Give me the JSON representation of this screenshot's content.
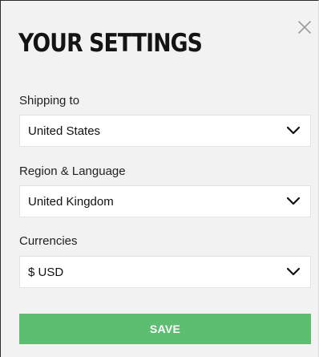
{
  "dialog": {
    "title": "YOUR SETTINGS",
    "close_icon": "close-icon"
  },
  "fields": {
    "shipping": {
      "label": "Shipping to",
      "value": "United States"
    },
    "region": {
      "label": "Region & Language",
      "value": "United Kingdom"
    },
    "currency": {
      "label": "Currencies",
      "value": "$ USD"
    }
  },
  "actions": {
    "save_label": "SAVE"
  },
  "colors": {
    "panel_background": "#f2f2f2",
    "save_button": "#5dbd70",
    "title_text": "#141414"
  }
}
